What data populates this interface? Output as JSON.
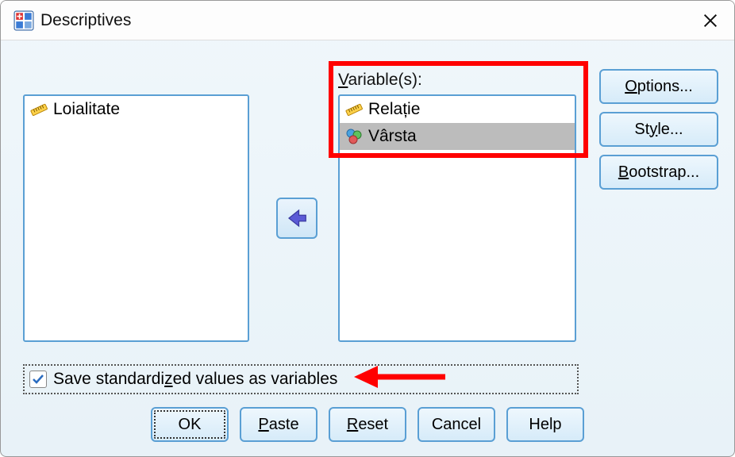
{
  "window": {
    "title": "Descriptives"
  },
  "lists": {
    "variables_label_prefix": "V",
    "variables_label_suffix": "ariable(s):",
    "source_items": [
      "Loialitate"
    ],
    "target_items": [
      {
        "label": "Relație",
        "type": "scale",
        "selected": false
      },
      {
        "label": "Vârsta",
        "type": "nominal",
        "selected": true
      }
    ]
  },
  "side_buttons": {
    "options": {
      "ul": "O",
      "rest": "ptions..."
    },
    "style": {
      "plain": "St",
      "ul": "y",
      "rest": "le..."
    },
    "bootstrap": {
      "ul": "B",
      "rest": "ootstrap..."
    }
  },
  "checkbox": {
    "checked": true,
    "label_pre": "Save standardi",
    "label_ul": "z",
    "label_post": "ed values as variables"
  },
  "buttons": {
    "ok": "OK",
    "paste": {
      "ul": "P",
      "rest": "aste"
    },
    "reset": {
      "ul": "R",
      "rest": "eset"
    },
    "cancel": "Cancel",
    "help": "Help"
  }
}
